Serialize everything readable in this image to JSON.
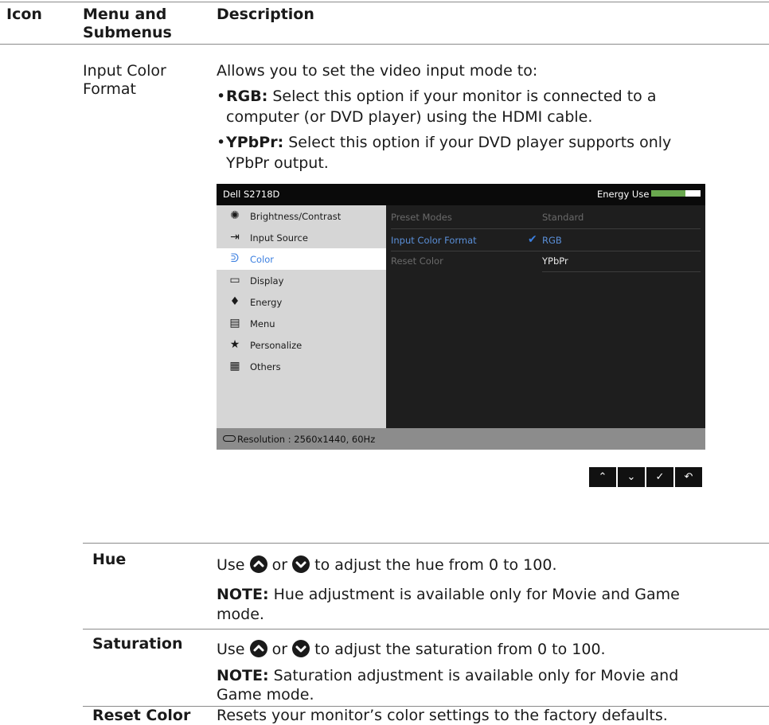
{
  "table": {
    "headers": {
      "icon": "Icon",
      "menu": "Menu and\nSubmenus",
      "description": "Description"
    },
    "input_color_format": {
      "label": "Input Color\nFormat",
      "intro": "Allows you to set the video input mode to:",
      "rgb_term": "RGB:",
      "rgb_text": "Select this option if your monitor is connected to a",
      "rgb_text2": "computer (or DVD player) using the HDMI cable.",
      "ypbpr_term": "YPbPr:",
      "ypbpr_text": "Select this option if your DVD player supports only",
      "ypbpr_text2": "YPbPr output."
    },
    "hue": {
      "label": "Hue",
      "use": "Use",
      "or": "or",
      "text": "to adjust the hue from 0 to 100.",
      "note_term": "NOTE:",
      "note_text": "Hue adjustment is available only for Movie and Game",
      "note_text2": "mode."
    },
    "saturation": {
      "label": "Saturation",
      "use": "Use",
      "or": "or",
      "text": "to adjust the saturation from 0 to 100.",
      "note_term": "NOTE:",
      "note_text": "Saturation adjustment is available only for Movie and",
      "note_text2": "Game mode."
    },
    "reset_color": {
      "label": "Reset Color",
      "text": "Resets your monitor’s color settings to the factory defaults."
    }
  },
  "osd": {
    "title": "Dell S2718D",
    "energy_label": "Energy Use",
    "energy_level": 0.7,
    "menu_items": [
      {
        "label": "Brightness/Contrast",
        "icon": "brightness-icon"
      },
      {
        "label": "Input Source",
        "icon": "input-source-icon"
      },
      {
        "label": "Color",
        "icon": "color-icon"
      },
      {
        "label": "Display",
        "icon": "display-icon"
      },
      {
        "label": "Energy",
        "icon": "energy-icon"
      },
      {
        "label": "Menu",
        "icon": "menu-icon"
      },
      {
        "label": "Personalize",
        "icon": "star-icon"
      },
      {
        "label": "Others",
        "icon": "others-icon"
      }
    ],
    "selected_menu": "Color",
    "submenu": [
      {
        "label": "Preset Modes",
        "value": "Standard"
      },
      {
        "label": "Input Color Format",
        "value": "RGB"
      },
      {
        "label": "Reset Color",
        "value": "YPbPr"
      }
    ],
    "footer": "Resolution : 2560x1440, 60Hz",
    "colors": {
      "energy_fill": "#6aa84f",
      "highlight_text": "#5a8fd8",
      "dim_text": "#6a6a6a",
      "check": "#3b7fe0"
    }
  },
  "nav_buttons": [
    {
      "name": "up",
      "glyph": "⌃"
    },
    {
      "name": "down",
      "glyph": "⌄"
    },
    {
      "name": "ok",
      "glyph": "✓"
    },
    {
      "name": "back",
      "glyph": "↶"
    }
  ]
}
